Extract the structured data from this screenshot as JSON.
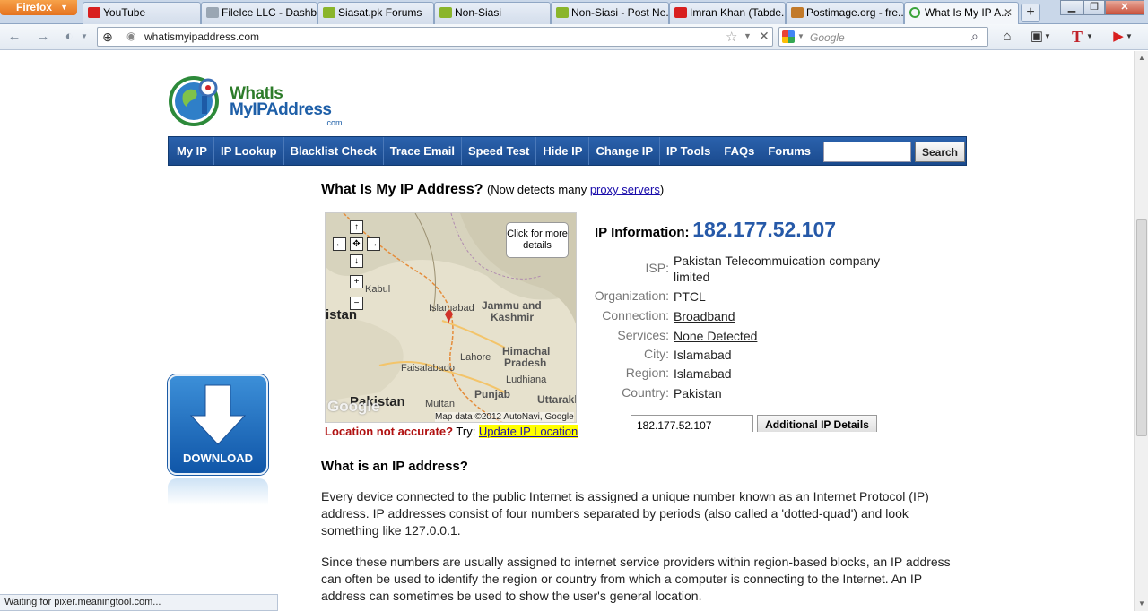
{
  "browser": {
    "app_menu": "Firefox",
    "tabs": [
      {
        "label": "YouTube",
        "color": "#d81f1f"
      },
      {
        "label": "FileIce LLC - Dashb...",
        "color": "#9aa6b3"
      },
      {
        "label": "Siasat.pk Forums",
        "color": "#8ab52a"
      },
      {
        "label": "Non-Siasi",
        "color": "#8ab52a"
      },
      {
        "label": "Non-Siasi - Post Ne...",
        "color": "#8ab52a"
      },
      {
        "label": "Imran Khan (Tabde...",
        "color": "#d81f1f"
      },
      {
        "label": "Postimage.org - fre...",
        "color": "#c27a2a"
      },
      {
        "label": "What Is My IP A...",
        "color": "#3aa33a"
      }
    ],
    "url": "whatismyipaddress.com",
    "search_placeholder": "Google",
    "status": "Waiting for pixer.meaningtool.com..."
  },
  "site": {
    "logo_line1": "WhatIs",
    "logo_line2": "MyIPAddress",
    "logo_com": ".com",
    "nav": [
      "My IP",
      "IP Lookup",
      "Blacklist Check",
      "Trace Email",
      "Speed Test",
      "Hide IP",
      "Change IP",
      "IP Tools",
      "FAQs",
      "Forums"
    ],
    "search_button": "Search",
    "download_label": "DOWNLOAD"
  },
  "main": {
    "headline": "What Is My IP Address?",
    "headline_sub_before": "(Now detects many ",
    "headline_link": "proxy servers",
    "headline_sub_after": ")",
    "map": {
      "callout": "Click for more details",
      "labels": {
        "kabul": "Kabul",
        "istan": "istan",
        "islamabad": "Islamabad",
        "jammu": "Jammu and",
        "kashmir": "Kashmir",
        "himachal": "Himachal",
        "pradesh": "Pradesh",
        "lahore": "Lahore",
        "faisalabad": "Faisalabado",
        "ludhiana": "Ludhiana",
        "punjab": "Punjab",
        "pakistan": "Pakistan",
        "multan": "Multan",
        "uttarakh": "Uttarakh"
      },
      "copyright": "Map data ©2012 AutoNavi, Google",
      "watermark": "Google"
    },
    "loc_warn": "Location not accurate?",
    "loc_try": " Try: ",
    "loc_link": "Update IP Location",
    "ip_label": "IP Information:",
    "ip": "182.177.52.107",
    "info": [
      {
        "key": "ISP:",
        "value": "Pakistan Telecommuication company limited",
        "link": false
      },
      {
        "key": "Organization:",
        "value": "PTCL",
        "link": false
      },
      {
        "key": "Connection:",
        "value": "Broadband",
        "link": true
      },
      {
        "key": "Services:",
        "value": "None Detected",
        "link": true
      },
      {
        "key": "City:",
        "value": "Islamabad",
        "link": false
      },
      {
        "key": "Region:",
        "value": "Islamabad",
        "link": false
      },
      {
        "key": "Country:",
        "value": "Pakistan",
        "link": false
      }
    ],
    "ip_input_value": "182.177.52.107",
    "ip_details_button": "Additional IP Details",
    "section_title": "What is an IP address?",
    "para1": "Every device connected to the public Internet is assigned a unique number known as an Internet Protocol (IP) address. IP addresses consist of four numbers separated by periods (also called a 'dotted-quad') and look something like 127.0.0.1.",
    "para2": "Since these numbers are usually assigned to internet service providers within region-based blocks, an IP address can often be used to identify the region or country from which a computer is connecting to the Internet. An IP address can sometimes be used to show the user's general location."
  }
}
